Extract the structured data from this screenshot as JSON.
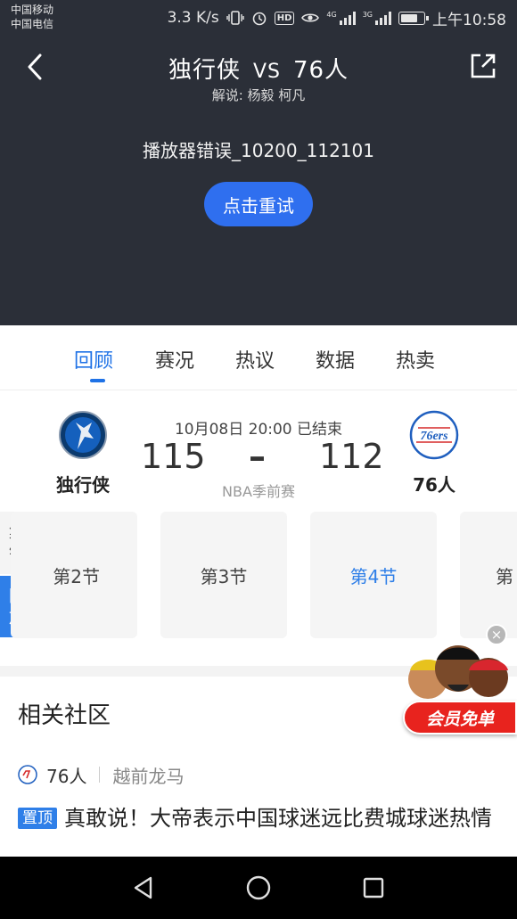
{
  "status_bar": {
    "carrier_1": "中国移动",
    "carrier_2": "中国电信",
    "network_speed": "3.3 K/s",
    "time": "上午10:58",
    "battery_level": 0.75,
    "icons": [
      "vibrate-icon",
      "alarm-icon",
      "hd-icon",
      "eye-icon",
      "signal-4g-icon",
      "signal-3g-icon",
      "battery-icon"
    ],
    "signal_tag_1": "4G",
    "signal_tag_2": "3G",
    "hd_label": "HD"
  },
  "header": {
    "home_team": "独行侠",
    "vs": "VS",
    "away_team": "76人",
    "commentary": "解说: 杨毅 柯凡",
    "error_text": "播放器错误_10200_112101",
    "retry_label": "点击重试",
    "background_color": "#2b2f38",
    "accent_color": "#2f6fef"
  },
  "tabs": [
    {
      "label": "回顾",
      "active": true
    },
    {
      "label": "赛况",
      "active": false
    },
    {
      "label": "热议",
      "active": false
    },
    {
      "label": "数据",
      "active": false
    },
    {
      "label": "热卖",
      "active": false
    }
  ],
  "match": {
    "datetime_status": "10月08日 20:00 已结束",
    "home_name": "独行侠",
    "home_score": "115",
    "dash": "–",
    "away_score": "112",
    "away_name": "76人",
    "league": "NBA季前赛",
    "away_logo_text": "76ers"
  },
  "video_strip": {
    "side_tabs": [
      {
        "label_1": "集",
        "label_2": "锦",
        "active": false
      },
      {
        "label_1": "回",
        "label_2": "放",
        "active": true
      }
    ],
    "quarters": [
      {
        "label": "第2节",
        "visible_text": "第2节",
        "active": false
      },
      {
        "label": "第3节",
        "visible_text": "第3节",
        "active": false
      },
      {
        "label": "第4节",
        "visible_text": "第4节",
        "active": true
      },
      {
        "label": "第",
        "visible_text": "第",
        "active": false
      }
    ]
  },
  "community": {
    "title": "相关社区",
    "post": {
      "team": "76人",
      "subforum": "越前龙马",
      "pin_label": "置顶",
      "title": "真敢说！大帝表示中国球迷远比费城球迷热情"
    }
  },
  "vip_ad": {
    "label": "会员免单",
    "close_symbol": "×"
  },
  "nav_bar": {
    "buttons": [
      "back-triangle-icon",
      "home-circle-icon",
      "recents-square-icon"
    ]
  }
}
